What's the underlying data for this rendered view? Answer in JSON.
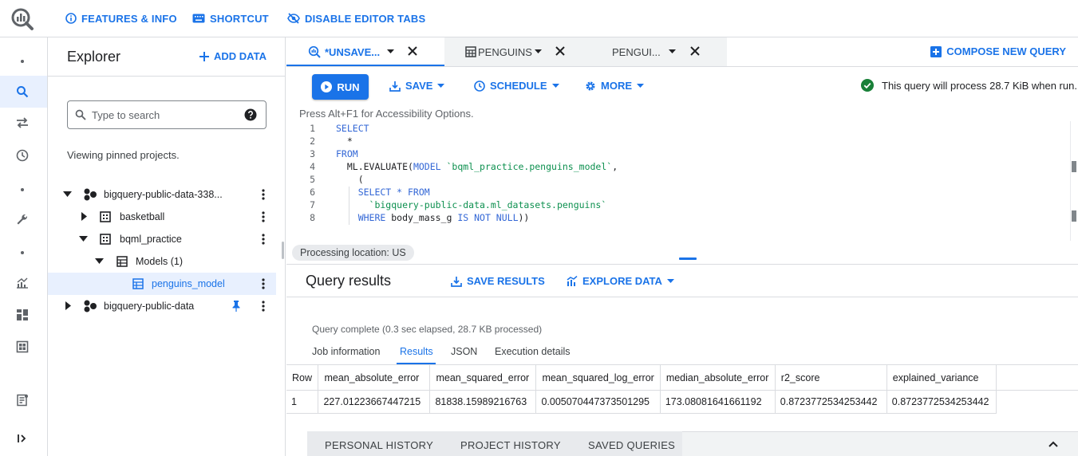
{
  "topbar": {
    "features": "FEATURES & INFO",
    "shortcut": "SHORTCUT",
    "disable_tabs": "DISABLE EDITOR TABS"
  },
  "rail": {
    "icons": [
      "dot",
      "search-icon",
      "transfers-icon",
      "history-icon",
      "dot",
      "wrench-icon",
      "dot",
      "analytics-icon",
      "dashboard-icon",
      "reservations-icon",
      "release-notes-icon",
      "expand-icon"
    ]
  },
  "explorer": {
    "title": "Explorer",
    "add_data": "ADD DATA",
    "search_placeholder": "Type to search",
    "pinned_note": "Viewing pinned projects.",
    "tree": [
      {
        "label": "bigquery-public-data-338..."
      },
      {
        "label": "basketball"
      },
      {
        "label": "bqml_practice"
      },
      {
        "label": "Models (1)"
      },
      {
        "label": "penguins_model"
      },
      {
        "label": "bigquery-public-data"
      }
    ]
  },
  "tabs": [
    {
      "label": "*UNSAVE..."
    },
    {
      "label": "PENGUINS"
    },
    {
      "label": "PENGUI..."
    }
  ],
  "compose": "COMPOSE NEW QUERY",
  "toolbar": {
    "run": "RUN",
    "save": "SAVE",
    "schedule": "SCHEDULE",
    "more": "MORE",
    "validator": "This query will process 28.7 KiB when run."
  },
  "editor": {
    "a11y_hint": "Press Alt+F1 for Accessibility Options.",
    "line_numbers": [
      "1",
      "2",
      "3",
      "4",
      "5",
      "6",
      "7",
      "8"
    ],
    "lines": [
      [
        {
          "t": "SELECT",
          "k": "kw"
        }
      ],
      [
        {
          "t": "  *",
          "k": ""
        }
      ],
      [
        {
          "t": "FROM",
          "k": "kw"
        }
      ],
      [
        {
          "t": "  ML.EVALUATE(",
          "k": ""
        },
        {
          "t": "MODEL",
          "k": "kw"
        },
        {
          "t": " `bqml_practice.penguins_model`",
          "k": "str"
        },
        {
          "t": ",",
          "k": ""
        }
      ],
      [
        {
          "t": "    (",
          "k": ""
        }
      ],
      [
        {
          "t": "    SELECT * FROM",
          "k": "kw"
        }
      ],
      [
        {
          "t": "      `bigquery-public-data.ml_datasets.penguins`",
          "k": "str"
        }
      ],
      [
        {
          "t": "    WHERE",
          "k": "kw"
        },
        {
          "t": " body_mass_g ",
          "k": ""
        },
        {
          "t": "IS NOT NULL",
          "k": "kw"
        },
        {
          "t": "))",
          "k": ""
        }
      ]
    ],
    "processing_location": "Processing location: US"
  },
  "results": {
    "title": "Query results",
    "save_results": "SAVE RESULTS",
    "explore_data": "EXPLORE DATA",
    "status": "Query complete (0.3 sec elapsed, 28.7 KB processed)",
    "tabs": [
      "Job information",
      "Results",
      "JSON",
      "Execution details"
    ],
    "columns": [
      "Row",
      "mean_absolute_error",
      "mean_squared_error",
      "mean_squared_log_error",
      "median_absolute_error",
      "r2_score",
      "explained_variance"
    ],
    "rows": [
      [
        "1",
        "227.01223667447215",
        "81838.15989216763",
        "0.005070447373501295",
        "173.08081641661192",
        "0.8723772534253442",
        "0.8723772534253442"
      ]
    ]
  },
  "history": {
    "tabs": [
      "PERSONAL HISTORY",
      "PROJECT HISTORY",
      "SAVED QUERIES"
    ]
  },
  "colors": {
    "accent": "#1a73e8",
    "success": "#188038"
  }
}
